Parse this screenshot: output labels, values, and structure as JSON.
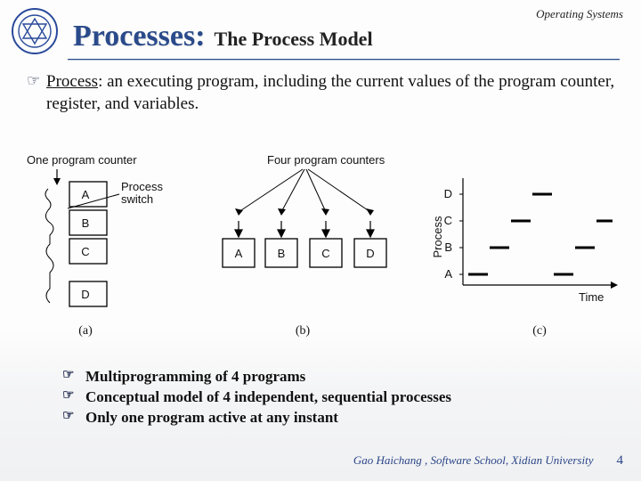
{
  "header": {
    "course": "Operating Systems",
    "title_main": "Processes:",
    "title_sub": "The Process Model"
  },
  "definition": {
    "term": "Process",
    "rest": ": an executing program, including the current values of the program counter, register, and variables."
  },
  "figure": {
    "a": {
      "label_top": "One program counter",
      "switch_label": "Process\nswitch",
      "boxes": [
        "A",
        "B",
        "C",
        "D"
      ],
      "caption": "(a)"
    },
    "b": {
      "label_top": "Four program counters",
      "boxes": [
        "A",
        "B",
        "C",
        "D"
      ],
      "caption": "(b)"
    },
    "c": {
      "ylabel": "Process",
      "xlabel": "Time",
      "rows": [
        "D",
        "C",
        "B",
        "A"
      ],
      "caption": "(c)"
    }
  },
  "bullets": [
    "Multiprogramming of 4 programs",
    "Conceptual model of 4 independent, sequential processes",
    "Only one program active at any instant"
  ],
  "footer": {
    "credit": "Gao Haichang , Software School, Xidian University",
    "page": "4"
  }
}
